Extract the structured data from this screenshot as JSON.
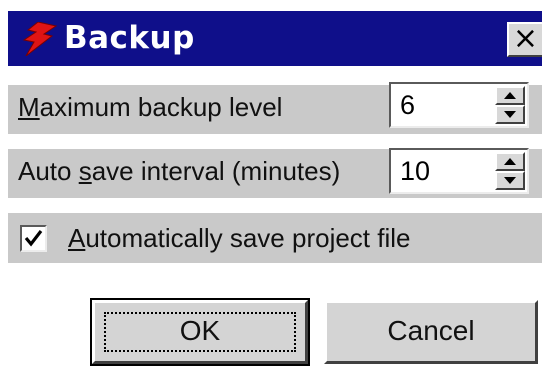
{
  "dialog": {
    "title": "Backup",
    "app_icon": "red-lightning-app-icon",
    "close_icon": "close-icon",
    "close_glyph": "×"
  },
  "fields": [
    {
      "label_mnemonic": "M",
      "label_rest": "aximum backup level",
      "value": "6"
    },
    {
      "label_prefix": "Auto ",
      "label_mnemonic": "s",
      "label_rest": "ave interval (minutes)",
      "value": "10"
    }
  ],
  "checkbox": {
    "label_mnemonic": "A",
    "label_rest": "utomatically save project file",
    "checked": true
  },
  "buttons": {
    "ok_label": "OK",
    "cancel_label": "Cancel"
  },
  "colors": {
    "titlebar": "#0f0f8a",
    "face": "#d4d4d4",
    "icon_red": "#e01414"
  }
}
